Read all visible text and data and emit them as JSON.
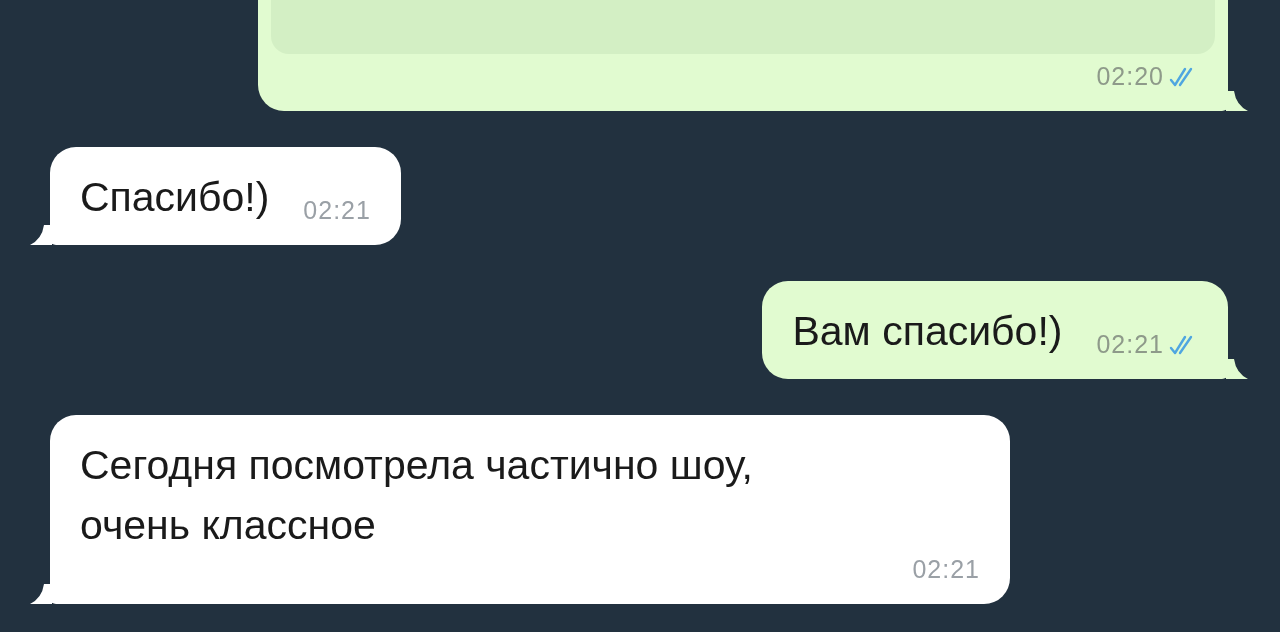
{
  "messages": [
    {
      "kind": "outgoing",
      "preview": true,
      "time": "02:20",
      "read": true
    },
    {
      "kind": "incoming",
      "text": "Спасибо!)",
      "time": "02:21"
    },
    {
      "kind": "outgoing",
      "text": "Вам спасибо!)",
      "time": "02:21",
      "read": true
    },
    {
      "kind": "incoming",
      "text": "Сегодня посмотрела частично шоу, очень классное",
      "time": "02:21"
    }
  ]
}
